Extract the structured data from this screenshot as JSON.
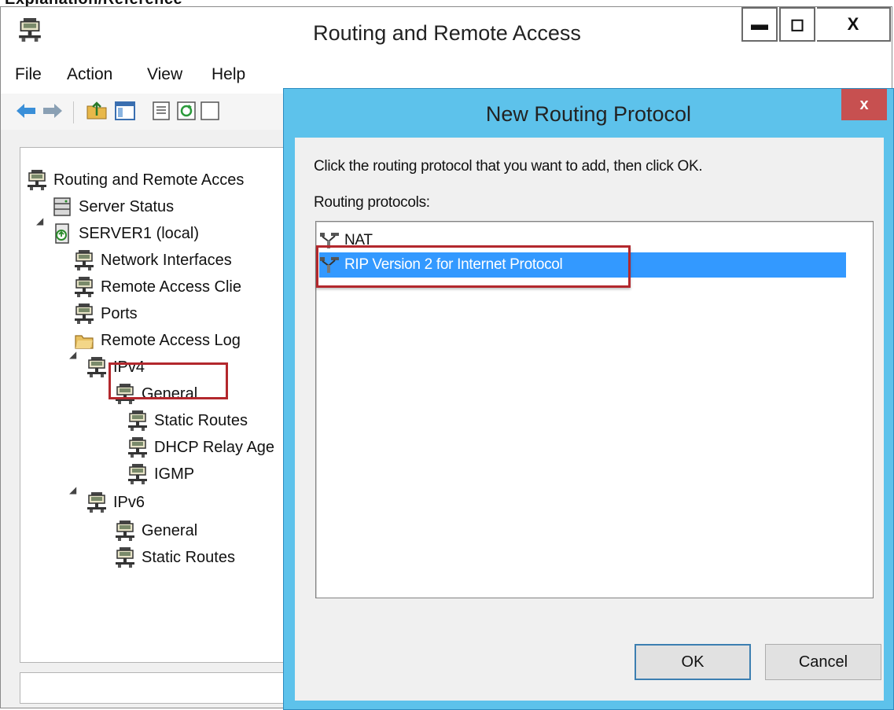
{
  "crop_heading": "Explanation/Reference",
  "main_window": {
    "title": "Routing and Remote Access",
    "controls": {
      "minimize": "▬",
      "maximize": "◻",
      "close": "X"
    },
    "app_icon": "routing-server-icon",
    "menu": [
      "File",
      "Action",
      "View",
      "Help"
    ],
    "toolbar_icons": [
      "back-arrow-icon",
      "forward-arrow-icon",
      "up-folder-icon",
      "show-hide-tree-icon",
      "properties-icon",
      "refresh-icon",
      "export-list-icon"
    ]
  },
  "tree": {
    "root": "Routing and Remote Acces",
    "server_status": "Server Status",
    "server": "SERVER1 (local)",
    "network_interfaces": "Network Interfaces",
    "remote_access_clients": "Remote Access Clie",
    "ports": "Ports",
    "remote_access_logging": "Remote Access Log",
    "ipv4": {
      "label": "IPv4",
      "general": "General",
      "static_routes": "Static Routes",
      "dhcp_relay": "DHCP Relay Age",
      "igmp": "IGMP"
    },
    "ipv6": {
      "label": "IPv6",
      "general": "General",
      "static_routes": "Static Routes"
    }
  },
  "dialog": {
    "title": "New Routing Protocol",
    "close": "x",
    "instruction": "Click the routing protocol that you want to add, then click OK.",
    "list_label": "Routing protocols:",
    "protocols": [
      {
        "label": "NAT",
        "icon": "protocol-icon",
        "selected": false
      },
      {
        "label": "RIP Version 2 for Internet Protocol",
        "icon": "protocol-icon",
        "selected": true
      }
    ],
    "ok": "OK",
    "cancel": "Cancel"
  },
  "colors": {
    "dialog_frame": "#5dc2eb",
    "dialog_close": "#c75050",
    "selection": "#3399ff",
    "annotation": "#b3282d"
  }
}
